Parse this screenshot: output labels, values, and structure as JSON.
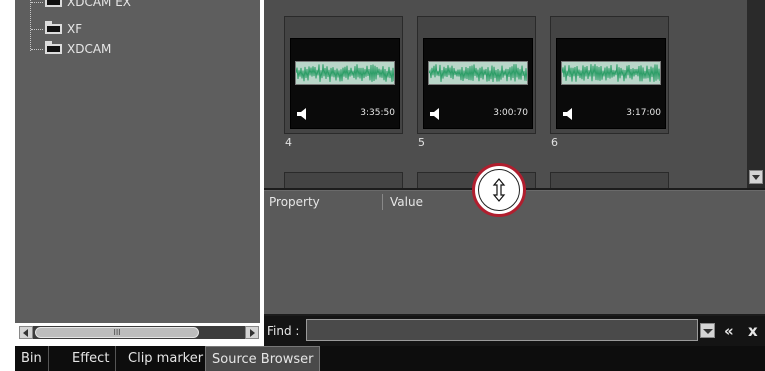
{
  "tree": {
    "items": [
      {
        "label": "XDCAM EX"
      },
      {
        "label": "XF"
      },
      {
        "label": "XDCAM"
      }
    ],
    "scroll_thumb_label": "III"
  },
  "clips": [
    {
      "number": "4",
      "duration": "3:35:50"
    },
    {
      "number": "5",
      "duration": "3:00:70"
    },
    {
      "number": "6",
      "duration": "3:17:00"
    }
  ],
  "properties": {
    "col_property": "Property",
    "col_value": "Value"
  },
  "find": {
    "label": "Find :",
    "value": "",
    "prev_symbol": "«",
    "close_symbol": "x"
  },
  "tabs": [
    {
      "label": "Bin"
    },
    {
      "label": "Effect"
    },
    {
      "label": "Clip marker"
    },
    {
      "label": "Source Browser"
    }
  ],
  "active_tab": "Source Browser",
  "colors": {
    "highlight_ring": "#b01e2e",
    "waveform": "#2e9e68",
    "waveform_bg": "#b9d6c9"
  },
  "icons": [
    "folder-icon",
    "speaker-icon",
    "resize-vertical-icon",
    "chevron-down-icon",
    "arrow-left-icon",
    "arrow-right-icon"
  ]
}
